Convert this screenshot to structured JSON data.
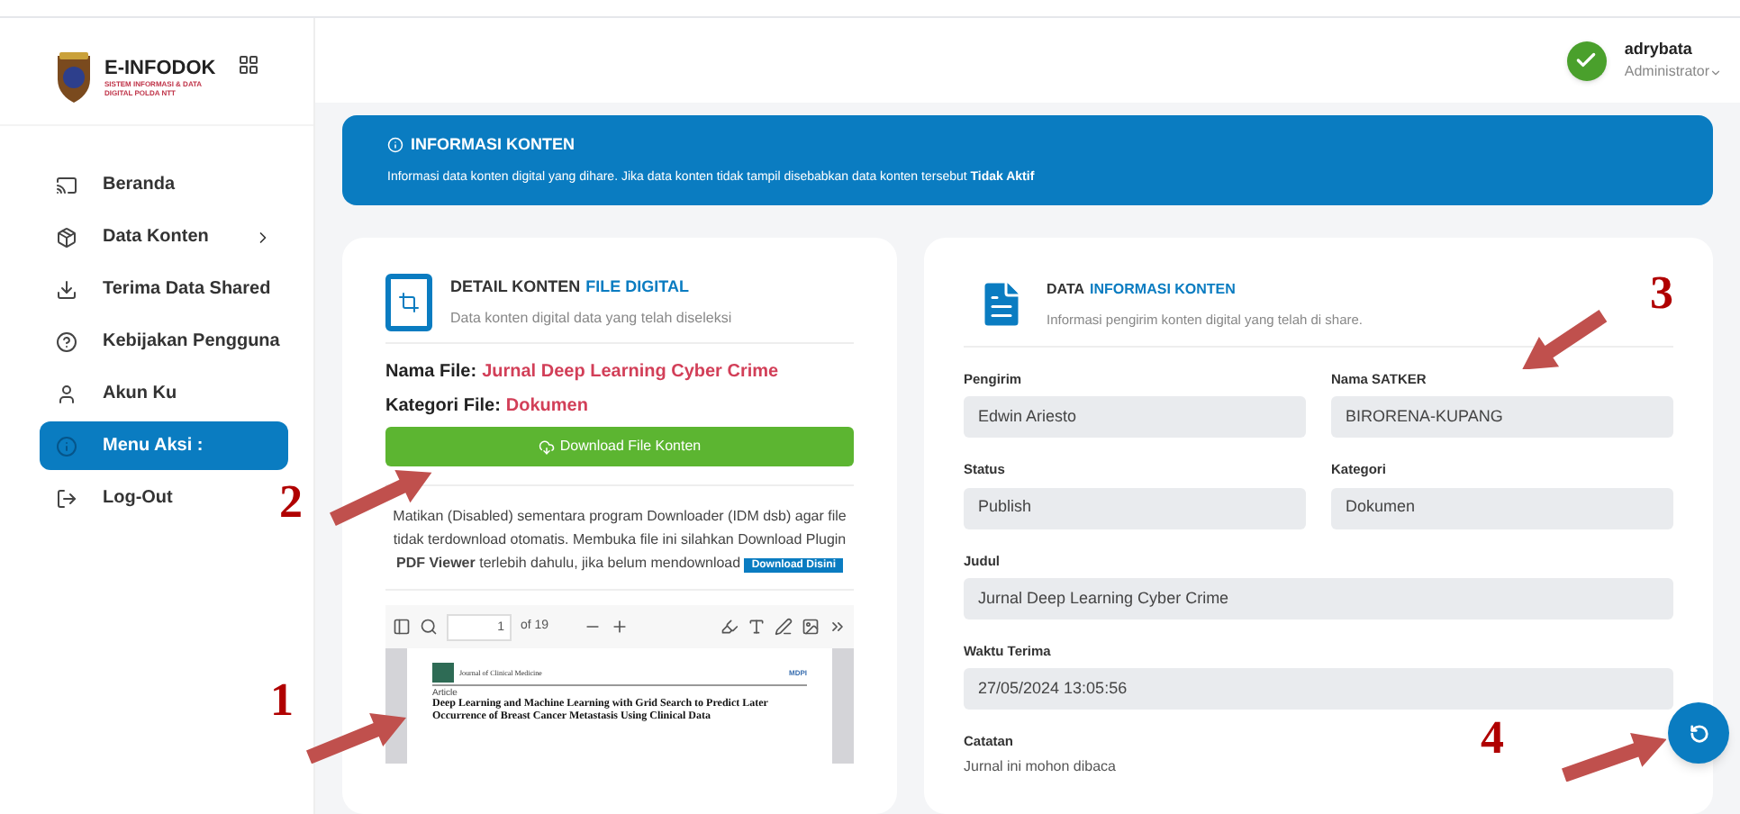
{
  "brand": {
    "name": "E-INFODOK",
    "tagline": "SISTEM INFORMASI & DATA DIGITAL POLDA NTT"
  },
  "sidebar": {
    "items": [
      {
        "label": "Beranda",
        "submenu": false,
        "selected": false
      },
      {
        "label": "Data Konten",
        "submenu": true,
        "selected": false
      },
      {
        "label": "Terima Data Shared",
        "submenu": false,
        "selected": false
      },
      {
        "label": "Kebijakan Pengguna",
        "submenu": false,
        "selected": false
      },
      {
        "label": "Akun Ku",
        "submenu": false,
        "selected": false
      },
      {
        "label": "Menu Aksi :",
        "submenu": false,
        "selected": true
      },
      {
        "label": "Log-Out",
        "submenu": false,
        "selected": false
      }
    ]
  },
  "user": {
    "name": "adrybata",
    "role": "Administrator"
  },
  "banner": {
    "title": "INFORMASI KONTEN",
    "text": "Informasi data konten digital yang dihare. Jika data konten tidak tampil disebabkan data konten tersebut **Tidak Aktif**"
  },
  "detail_card": {
    "title": "DETAIL KONTEN",
    "title_highlight": "FILE DIGITAL",
    "subtitle": "Data konten digital data yang telah diseleksi",
    "file_name_label": "Nama File:",
    "file_name": "Jurnal Deep Learning Cyber Crime",
    "category_label": "Kategori File:",
    "category": "Dokumen",
    "download_button": "Download File Konten",
    "notice": "Matikan (Disabled) sementara program Downloader (IDM dsb) agar file tidak terdownload otomatis. Membuka file ini silahkan Download Plugin **PDF Viewer** terlebih dahulu, jika belum mendownload",
    "notice_button": "Download Disini",
    "viewer": {
      "page": "1",
      "page_count": "of 19",
      "journal": "Journal of Clinical Medicine",
      "publisher": "MDPI",
      "doc_type": "Article",
      "doc_title": "Deep Learning and Machine Learning with Grid Search to Predict Later Occurrence of Breast Cancer Metastasis Using Clinical Data"
    }
  },
  "info_card": {
    "title": "DATA",
    "title_highlight": "INFORMASI KONTEN",
    "subtitle": "Informasi pengirim konten digital yang telah di share.",
    "rows": [
      [
        {
          "label": "Pengirim",
          "value": "Edwin Ariesto",
          "kind": "input"
        },
        {
          "label": "Nama SATKER",
          "value": "BIRORENA-KUPANG",
          "kind": "input"
        }
      ],
      [
        {
          "label": "Status",
          "value": "Publish",
          "kind": "input"
        },
        {
          "label": "Kategori",
          "value": "Dokumen",
          "kind": "input"
        }
      ],
      [
        {
          "label": "Judul",
          "value": "Jurnal Deep Learning Cyber Crime",
          "kind": "input"
        }
      ],
      [
        {
          "label": "Waktu Terima",
          "value": "27/05/2024 13:05:56",
          "kind": "input"
        }
      ],
      [
        {
          "label": "Catatan",
          "value": "Jurnal ini mohon dibaca",
          "kind": "text"
        }
      ]
    ]
  },
  "annotations": [
    {
      "number": "1"
    },
    {
      "number": "2"
    },
    {
      "number": "3"
    },
    {
      "number": "4"
    }
  ]
}
